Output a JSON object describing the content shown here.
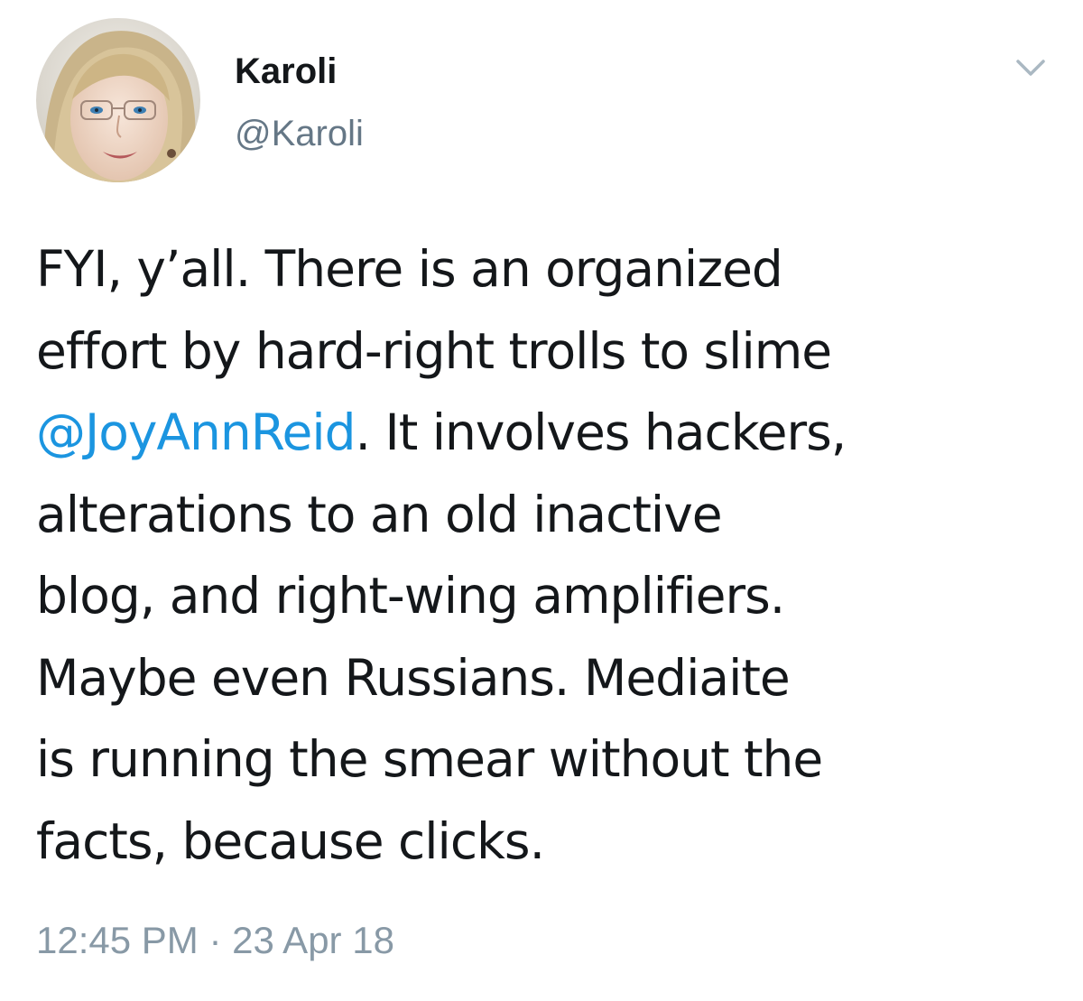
{
  "author": {
    "display_name": "Karoli",
    "handle": "@Karoli"
  },
  "tweet": {
    "line1": "FYI, y’all. There is an organized",
    "line2": "effort by hard-right trolls to slime",
    "mention": "@JoyAnnReid",
    "line3_rest": ". It involves hackers,",
    "line4": "alterations to an old inactive",
    "line5": "blog, and right-wing amplifiers.",
    "line6": "Maybe even Russians. Mediaite",
    "line7": "is running the smear without the",
    "line8": "facts, because clicks."
  },
  "meta": {
    "time": "12:45 PM",
    "separator": " · ",
    "date": "23 Apr 18"
  },
  "icons": {
    "menu_caret": "chevron-down-icon",
    "avatar": "profile-photo"
  },
  "colors": {
    "text": "#14171a",
    "handle": "#657786",
    "link": "#1b95e0",
    "timestamp": "#8899a6"
  }
}
